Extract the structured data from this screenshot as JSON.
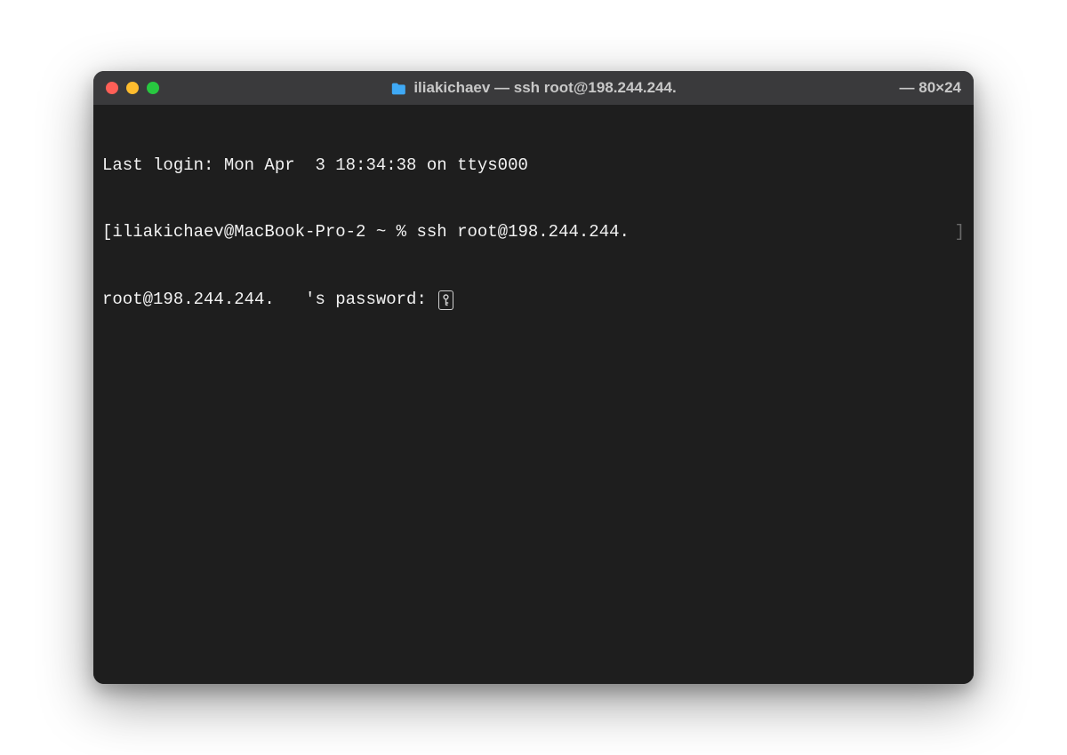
{
  "titlebar": {
    "folder_icon": "folder-icon",
    "title": "iliakichaev — ssh root@198.244.244.",
    "dimensions": "— 80×24"
  },
  "terminal": {
    "line1": "Last login: Mon Apr  3 18:34:38 on ttys000",
    "line2_left": "[iliakichaev@MacBook-Pro-2 ~ % ssh root@198.244.244.",
    "line2_right": "]",
    "line3_prefix": "root@198.244.244.   's password: ",
    "key_icon": "key-icon"
  }
}
